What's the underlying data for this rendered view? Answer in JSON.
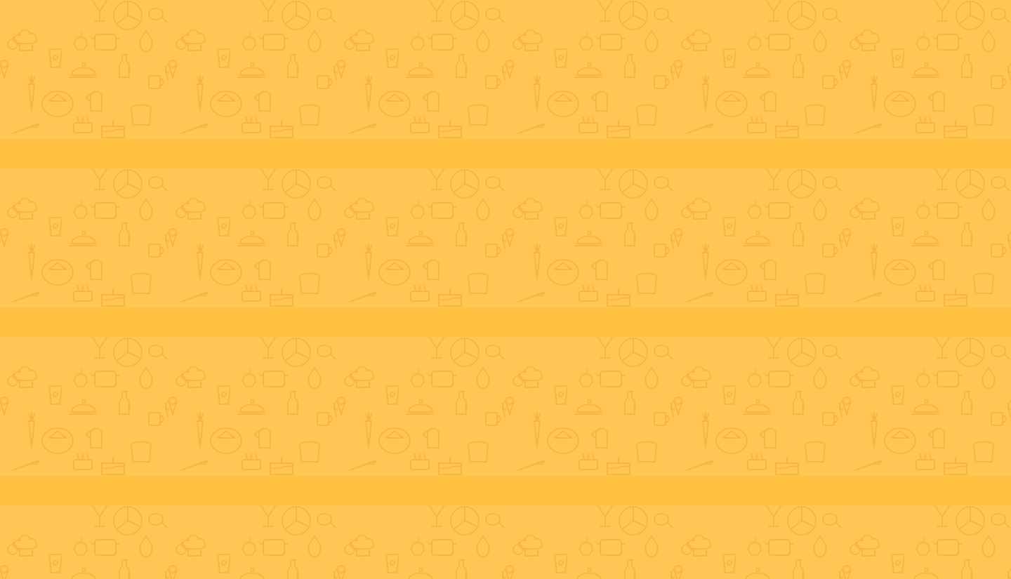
{
  "page": {
    "background_color": "#ffc656",
    "pattern_color": "#f5b43a",
    "stripe_color": "#ffbf3f",
    "pattern_icons": [
      "chef-hat-icon",
      "cloche-icon",
      "carrot-icon",
      "ice-cream-cone-icon",
      "cup-icon",
      "pizza-icon",
      "apple-icon",
      "oven-mitt-icon",
      "cooking-pot-icon",
      "bread-icon",
      "cake-icon",
      "bottle-icon",
      "cocktail-glass-icon",
      "pear-icon"
    ]
  },
  "stripes": [
    {
      "name": "stripe-1"
    },
    {
      "name": "stripe-2"
    },
    {
      "name": "stripe-3"
    }
  ]
}
